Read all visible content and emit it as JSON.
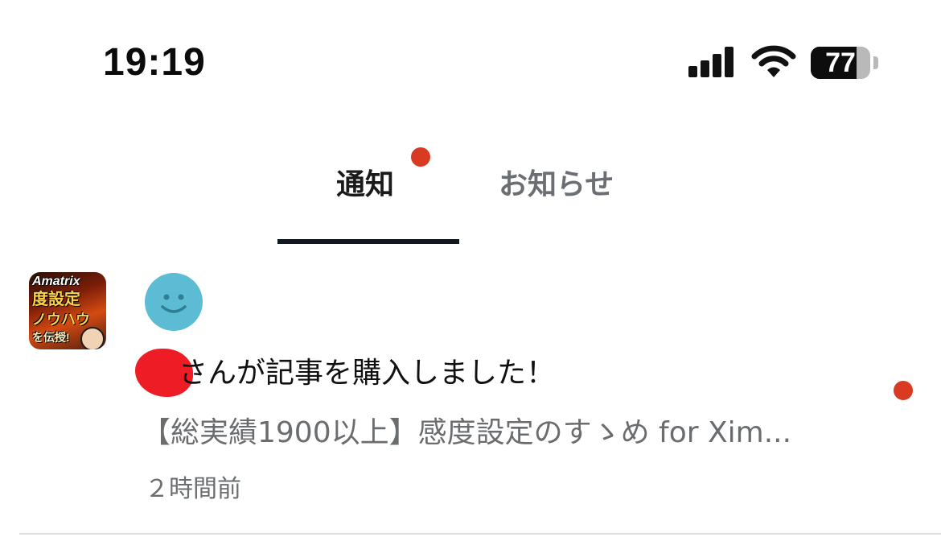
{
  "status_bar": {
    "time": "19:19",
    "battery_level": "77",
    "signal_bars": 4
  },
  "tabs": [
    {
      "label": "通知",
      "active": true,
      "has_badge": true
    },
    {
      "label": "お知らせ",
      "active": false,
      "has_badge": false
    }
  ],
  "notification": {
    "thumbnail": {
      "line1": "Amatrix",
      "line2": "度設定",
      "line3": "ノウハウ",
      "line4": "を伝授!"
    },
    "avatar_icon": "smiley-face-icon",
    "message": "さんが記事を購入しました！",
    "article_title": "【総実績1900以上】感度設定のすゝめ for Xim...",
    "time_ago": "２時間前",
    "unread": true
  },
  "colors": {
    "badge": "#d93a22",
    "active_tab_underline": "#111820",
    "avatar_bg": "#5bbcd3",
    "redaction": "#ee1c25"
  }
}
